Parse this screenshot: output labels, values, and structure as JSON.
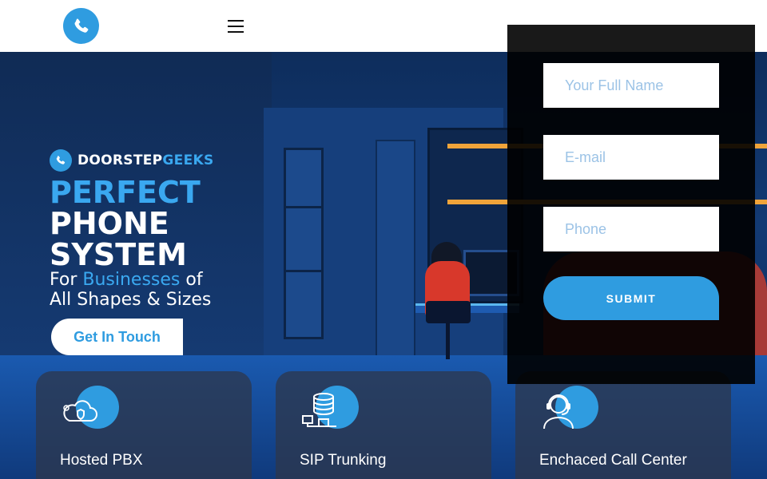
{
  "header": {
    "logo_icon": "phone-icon",
    "menu_icon": "hamburger-menu-icon"
  },
  "hero": {
    "brand_prefix": "DOORSTEP",
    "brand_suffix": "GEEKS",
    "headline_line1": "PERFECT",
    "headline_line2": "PHONE",
    "headline_line3": "SYSTEM",
    "subhead_part1": "For ",
    "subhead_accent": "Businesses",
    "subhead_part2": " of",
    "subhead_line2": "All Shapes & Sizes",
    "cta_label": "Get In Touch"
  },
  "form": {
    "name_placeholder": "Your Full Name",
    "email_placeholder": "E-mail",
    "phone_placeholder": "Phone",
    "submit_label": "SUBMIT"
  },
  "services": [
    {
      "title": "Hosted PBX",
      "icon": "cloud-security-icon"
    },
    {
      "title": "SIP Trunking",
      "icon": "server-network-icon"
    },
    {
      "title": "Enchaced Call Center",
      "icon": "headset-agent-icon"
    }
  ],
  "colors": {
    "accent": "#2f9ce0",
    "header_bg": "#ffffff",
    "panel_bg": "#000000"
  }
}
